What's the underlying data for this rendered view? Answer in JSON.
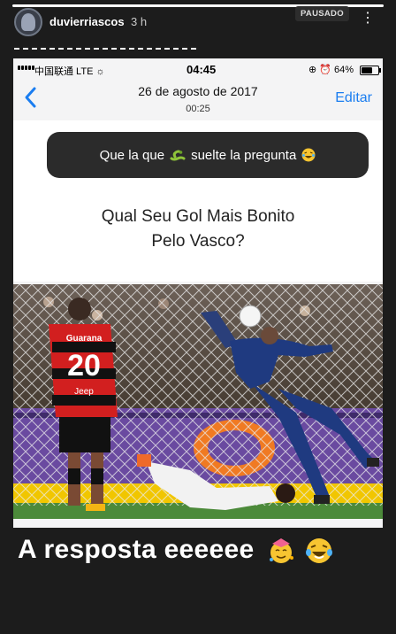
{
  "story": {
    "username": "duvierriascos",
    "time_ago": "3 h",
    "paused_label": "PAUSADO",
    "more_icon": "more-vertical-icon"
  },
  "phone": {
    "status_bar": {
      "carrier": "中国联通  LTE ☼",
      "time": "04:45",
      "icons": "⊕ ⏰ 64%",
      "battery_level": 0.64
    },
    "nav": {
      "date": "26 de agosto de 2017",
      "time": "00:25",
      "edit_label": "Editar"
    },
    "question_sticker": {
      "text_before": "Que la que",
      "text_after": "suelte la pregunta"
    },
    "post_title_line1": "Qual Seu Gol Mais Bonito",
    "post_title_line2": "Pelo Vasco?",
    "photo": {
      "jersey_name": "Guarana",
      "jersey_number": "20",
      "sponsor": "Jeep"
    }
  },
  "answer_text": "A resposta eeeeee",
  "colors": {
    "accent_blue": "#1a7df0",
    "sticker_bg": "#2b2b2b",
    "background": "#1c1c1c"
  }
}
